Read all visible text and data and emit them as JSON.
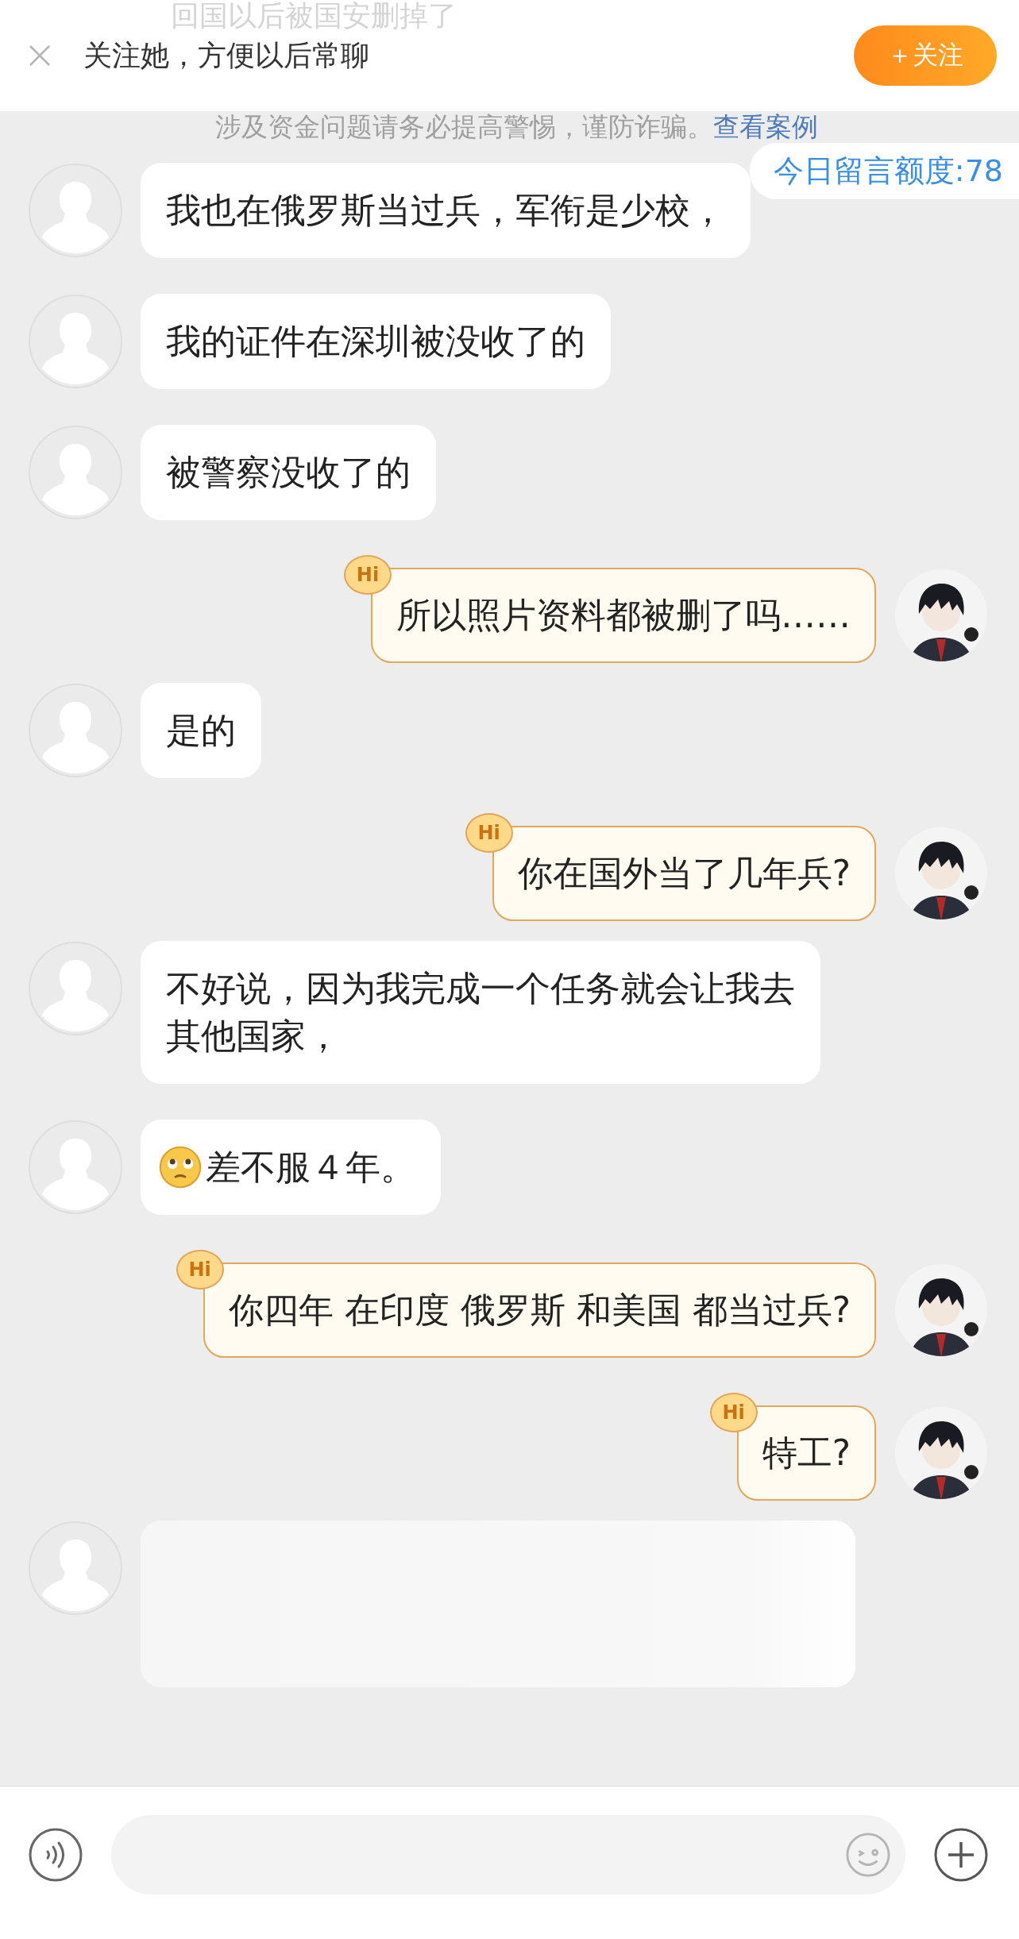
{
  "banner": {
    "hidden_message": "回国以后被国安删掉了",
    "title": "关注她，方便以后常聊",
    "follow_button": "＋关注"
  },
  "notice": {
    "text": "涉及资金问题请务必提高警惕，谨防诈骗。",
    "link": "查看案例"
  },
  "quota": "今日留言额度:78",
  "messages": [
    {
      "outgoing": false,
      "kind": "text",
      "text": "我也在俄罗斯当过兵，军衔是少校，"
    },
    {
      "outgoing": false,
      "kind": "text",
      "text": "我的证件在深圳被没收了的"
    },
    {
      "outgoing": false,
      "kind": "text",
      "text": "被警察没收了的"
    },
    {
      "outgoing": true,
      "kind": "text",
      "badge": "Hi",
      "text": "所以照片资料都被删了吗……"
    },
    {
      "outgoing": false,
      "kind": "text",
      "text": "是的"
    },
    {
      "outgoing": true,
      "kind": "text",
      "badge": "Hi",
      "text": "你在国外当了几年兵?"
    },
    {
      "outgoing": false,
      "kind": "text",
      "text": "不好说，因为我完成一个任务就会让我去其他国家，"
    },
    {
      "outgoing": false,
      "kind": "emoji",
      "text": "差不服４年。"
    },
    {
      "outgoing": true,
      "kind": "text",
      "badge": "Hi",
      "text": "你四年 在印度 俄罗斯 和美国 都当过兵?"
    },
    {
      "outgoing": true,
      "kind": "text",
      "badge": "Hi",
      "text": "特工?"
    },
    {
      "outgoing": false,
      "kind": "blurred"
    }
  ]
}
